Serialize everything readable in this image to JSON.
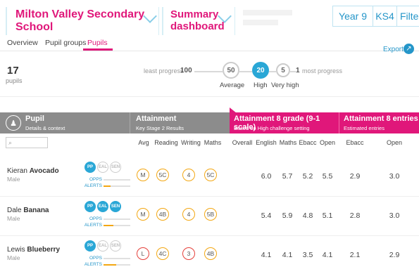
{
  "header": {
    "school": "Milton Valley Secondary School",
    "dashboard": "Summary dashboard",
    "year": "Year 9",
    "stage": "KS4",
    "filters": "Filters"
  },
  "tabs": [
    {
      "label": "Overview"
    },
    {
      "label": "Pupil groups"
    },
    {
      "label": "Pupils"
    }
  ],
  "export_label": "Export",
  "summary": {
    "count": "17",
    "count_label": "pupils",
    "least_label": "least progress",
    "least_value": "100",
    "most_value": "1",
    "most_label": "most progress",
    "average_value": "50",
    "high_value": "20",
    "very_high_value": "5",
    "average_label": "Average",
    "high_label": "High",
    "very_high_label": "Very high"
  },
  "columns": {
    "pupil_title": "Pupil",
    "pupil_sub": "Details & context",
    "att_title": "Attainment",
    "att_sub": "Key Stage 2 Results",
    "a8_title": "Attainment 8 grade (9-1 scale)",
    "a8_sub": "Based on High challenge setting",
    "a8e_title": "Attainment 8 entries",
    "a8e_sub": "Estimated entries",
    "search_placeholder": "⌕",
    "att_cols": [
      "Avg",
      "Reading",
      "Writing",
      "Maths"
    ],
    "a8_cols": [
      "Overall",
      "English",
      "Maths",
      "Ebacc",
      "Open"
    ],
    "a8e_cols": [
      "Ebacc",
      "Open"
    ]
  },
  "chips": [
    "PP",
    "EAL",
    "SEN"
  ],
  "opps_label": "OPPS",
  "alerts_label": "ALERTS",
  "colors": {
    "accent": "#e0177a",
    "blue": "#2aa7d6",
    "grey": "#8c8c8c",
    "orange": "#f3a712",
    "red": "#e5403a"
  },
  "rows": [
    {
      "first": "Kieran",
      "last": "Avocado",
      "gender": "Male",
      "chips_on": [
        true,
        false,
        false
      ],
      "ks2": [
        "M",
        "5C",
        "4",
        "5C"
      ],
      "ks2_red": [
        false,
        false,
        false,
        false
      ],
      "a8": [
        "",
        "6.0",
        "5.7",
        "5.2",
        "5.5"
      ],
      "entries": [
        "2.9",
        "3.0"
      ]
    },
    {
      "first": "Dale",
      "last": "Banana",
      "gender": "Male",
      "chips_on": [
        true,
        true,
        true
      ],
      "ks2": [
        "M",
        "4B",
        "4",
        "5B"
      ],
      "ks2_red": [
        false,
        false,
        false,
        false
      ],
      "a8": [
        "",
        "5.4",
        "5.9",
        "4.8",
        "5.1"
      ],
      "entries": [
        "2.8",
        "3.0"
      ]
    },
    {
      "first": "Lewis",
      "last": "Blueberry",
      "gender": "Male",
      "chips_on": [
        true,
        false,
        false
      ],
      "ks2": [
        "L",
        "4C",
        "3",
        "4B"
      ],
      "ks2_red": [
        true,
        false,
        true,
        false
      ],
      "a8": [
        "",
        "4.1",
        "4.1",
        "3.5",
        "4.1"
      ],
      "entries": [
        "2.1",
        "2.9"
      ]
    }
  ]
}
